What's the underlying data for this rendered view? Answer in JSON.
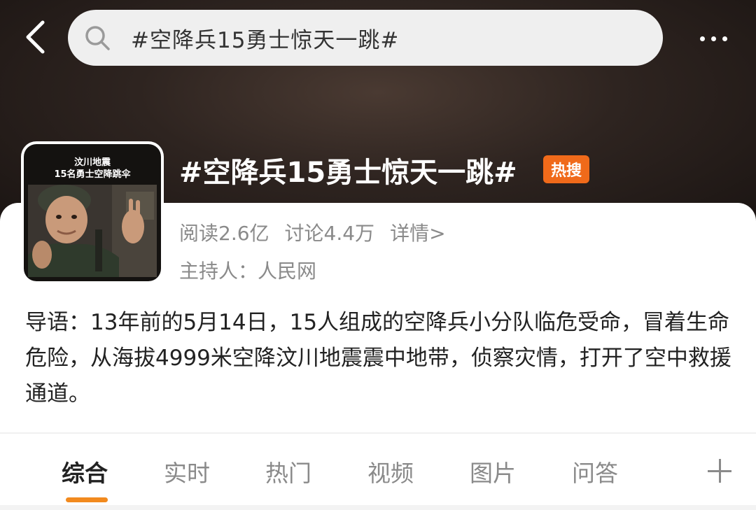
{
  "search": {
    "query": "#空降兵15勇士惊天一跳#"
  },
  "topic": {
    "title": "#空降兵15勇士惊天一跳#",
    "hot_badge": "热搜",
    "thumbnail_caption_line1": "汶川地震",
    "thumbnail_caption_line2": "15名勇士空降跳伞",
    "reads": "阅读2.6亿",
    "discussions": "讨论4.4万",
    "details_link": "详情>",
    "host": "主持人：人民网",
    "intro": "导语：13年前的5月14日，15人组成的空降兵小分队临危受命，冒着生命危险，从海拔4999米空降汶川地震震中地带，侦察灾情，打开了空中救援通道。"
  },
  "tabs": [
    {
      "label": "综合",
      "active": true
    },
    {
      "label": "实时",
      "active": false
    },
    {
      "label": "热门",
      "active": false
    },
    {
      "label": "视频",
      "active": false
    },
    {
      "label": "图片",
      "active": false
    },
    {
      "label": "问答",
      "active": false
    }
  ],
  "colors": {
    "accent_orange": "#f28a1e",
    "hot_badge": "#f06a1a",
    "header_dark": "#2e2420"
  },
  "icons": {
    "back": "chevron-left-icon",
    "search": "search-icon",
    "more": "more-dots-icon",
    "add_tab": "plus-icon"
  }
}
